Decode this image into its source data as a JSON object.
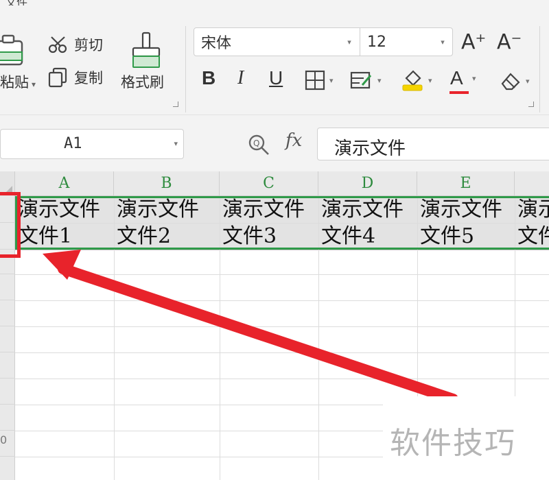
{
  "window": {
    "title_fragment": "文件"
  },
  "clipboard": {
    "paste_label": "粘贴",
    "cut_label": "剪切",
    "copy_label": "复制",
    "format_painter_label": "格式刷"
  },
  "font": {
    "family_value": "宋体",
    "size_value": "12",
    "increase_label": "A⁺",
    "decrease_label": "A⁻"
  },
  "format_tools": {
    "bold": "B",
    "italic": "I",
    "underline": "U",
    "font_color_letter": "A",
    "font_color_hex": "#e8232b",
    "fill_color_hex": "#f5d400"
  },
  "formula_bar": {
    "name_box_value": "A1",
    "fx_label": "fx",
    "formula_value": "演示文件"
  },
  "sheet": {
    "columns": [
      "A",
      "B",
      "C",
      "D",
      "E"
    ],
    "row1": [
      "演示文件",
      "演示文件",
      "演示文件",
      "演示文件",
      "演示文件",
      "演示文"
    ],
    "row2": [
      "文件1",
      "文件2",
      "文件3",
      "文件4",
      "文件5",
      "文件"
    ],
    "selection_color": "#2f9a49",
    "visible_row_fragment": "0"
  },
  "annotation": {
    "highlight_color": "#e8232b",
    "watermark_text": "软件技巧"
  }
}
